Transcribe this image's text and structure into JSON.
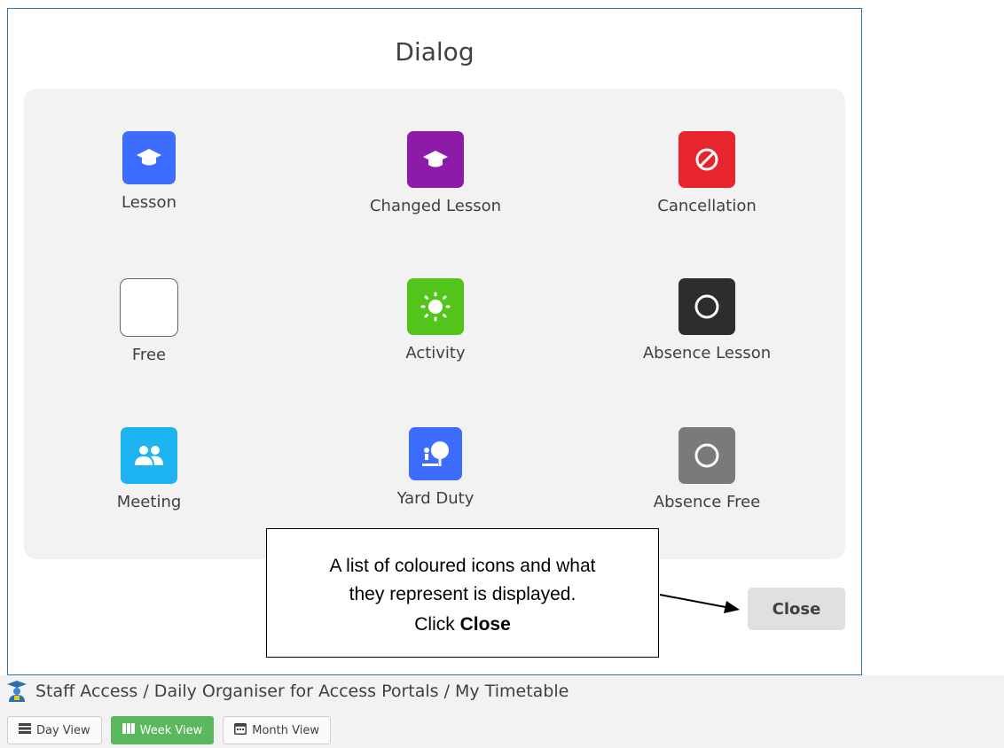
{
  "dialog": {
    "title": "Dialog",
    "legend": [
      {
        "label": "Lesson",
        "icon": "graduation-cap-icon",
        "color": "#3d6dff"
      },
      {
        "label": "Changed Lesson",
        "icon": "graduation-cap-icon",
        "color": "#8e1aa8"
      },
      {
        "label": "Cancellation",
        "icon": "cancel-circle-icon",
        "color": "#e8252f"
      },
      {
        "label": "Free",
        "icon": "blank-square-icon",
        "color": "#ffffff"
      },
      {
        "label": "Activity",
        "icon": "sun-icon",
        "color": "#52c41a"
      },
      {
        "label": "Absence Lesson",
        "icon": "circle-outline-icon",
        "color": "#2d2d2d"
      },
      {
        "label": "Meeting",
        "icon": "people-icon",
        "color": "#1db3f0"
      },
      {
        "label": "Yard Duty",
        "icon": "tree-person-icon",
        "color": "#3d6dff"
      },
      {
        "label": "Absence Free",
        "icon": "circle-outline-icon",
        "color": "#7a7a7a"
      }
    ],
    "close_label": "Close"
  },
  "callout": {
    "line1": "A list of coloured icons and what",
    "line2": "they represent is displayed.",
    "line3_prefix": "Click ",
    "line3_bold": "Close"
  },
  "breadcrumb": {
    "text": "Staff Access / Daily Organiser for Access Portals / My Timetable"
  },
  "views": {
    "day": "Day View",
    "week": "Week View",
    "month": "Month View",
    "active": "week",
    "active_color": "#5cb85c"
  }
}
